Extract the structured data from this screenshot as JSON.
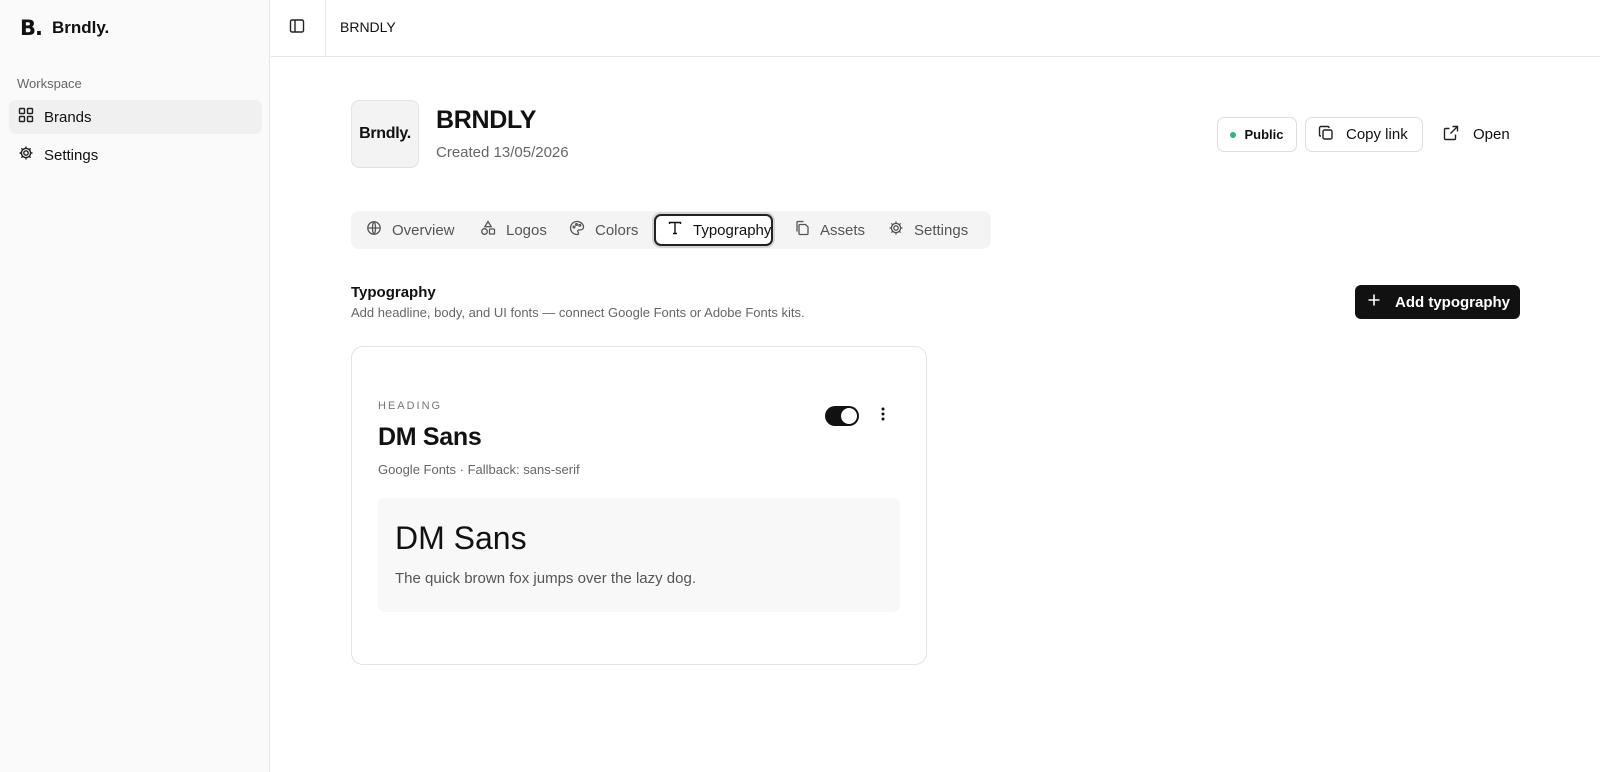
{
  "sidebar": {
    "logo_mark": "B.",
    "logo_text": "Brndly.",
    "section_label": "Workspace",
    "items": [
      {
        "label": "Brands",
        "icon": "grid-icon",
        "active": true
      },
      {
        "label": "Settings",
        "icon": "gear-icon",
        "active": false
      }
    ]
  },
  "topbar": {
    "toggle_icon": "sidebar-toggle-icon",
    "breadcrumb": "BRNDLY"
  },
  "brand": {
    "logo_text": "Brndly.",
    "name": "BRNDLY",
    "created": "Created 13/05/2026"
  },
  "actions": {
    "visibility_label": "Public",
    "visibility_color": "#34b27b",
    "copy_label": "Copy link",
    "open_label": "Open"
  },
  "tabs": [
    {
      "label": "Overview",
      "icon": "globe-icon",
      "active": false
    },
    {
      "label": "Logos",
      "icon": "shapes-icon",
      "active": false
    },
    {
      "label": "Colors",
      "icon": "palette-icon",
      "active": false
    },
    {
      "label": "Typography",
      "icon": "type-icon",
      "active": true
    },
    {
      "label": "Assets",
      "icon": "files-icon",
      "active": false
    },
    {
      "label": "Settings",
      "icon": "gear-icon",
      "active": false
    }
  ],
  "section": {
    "title": "Typography",
    "description": "Add headline, body, and UI fonts — connect Google Fonts or Adobe Fonts kits.",
    "add_label": "Add typography"
  },
  "font_card": {
    "kind": "HEADING",
    "name": "DM Sans",
    "meta": "Google Fonts · Fallback: sans-serif",
    "enabled": true,
    "preview_name": "DM Sans",
    "preview_sample": "The quick brown fox jumps over the lazy dog."
  }
}
